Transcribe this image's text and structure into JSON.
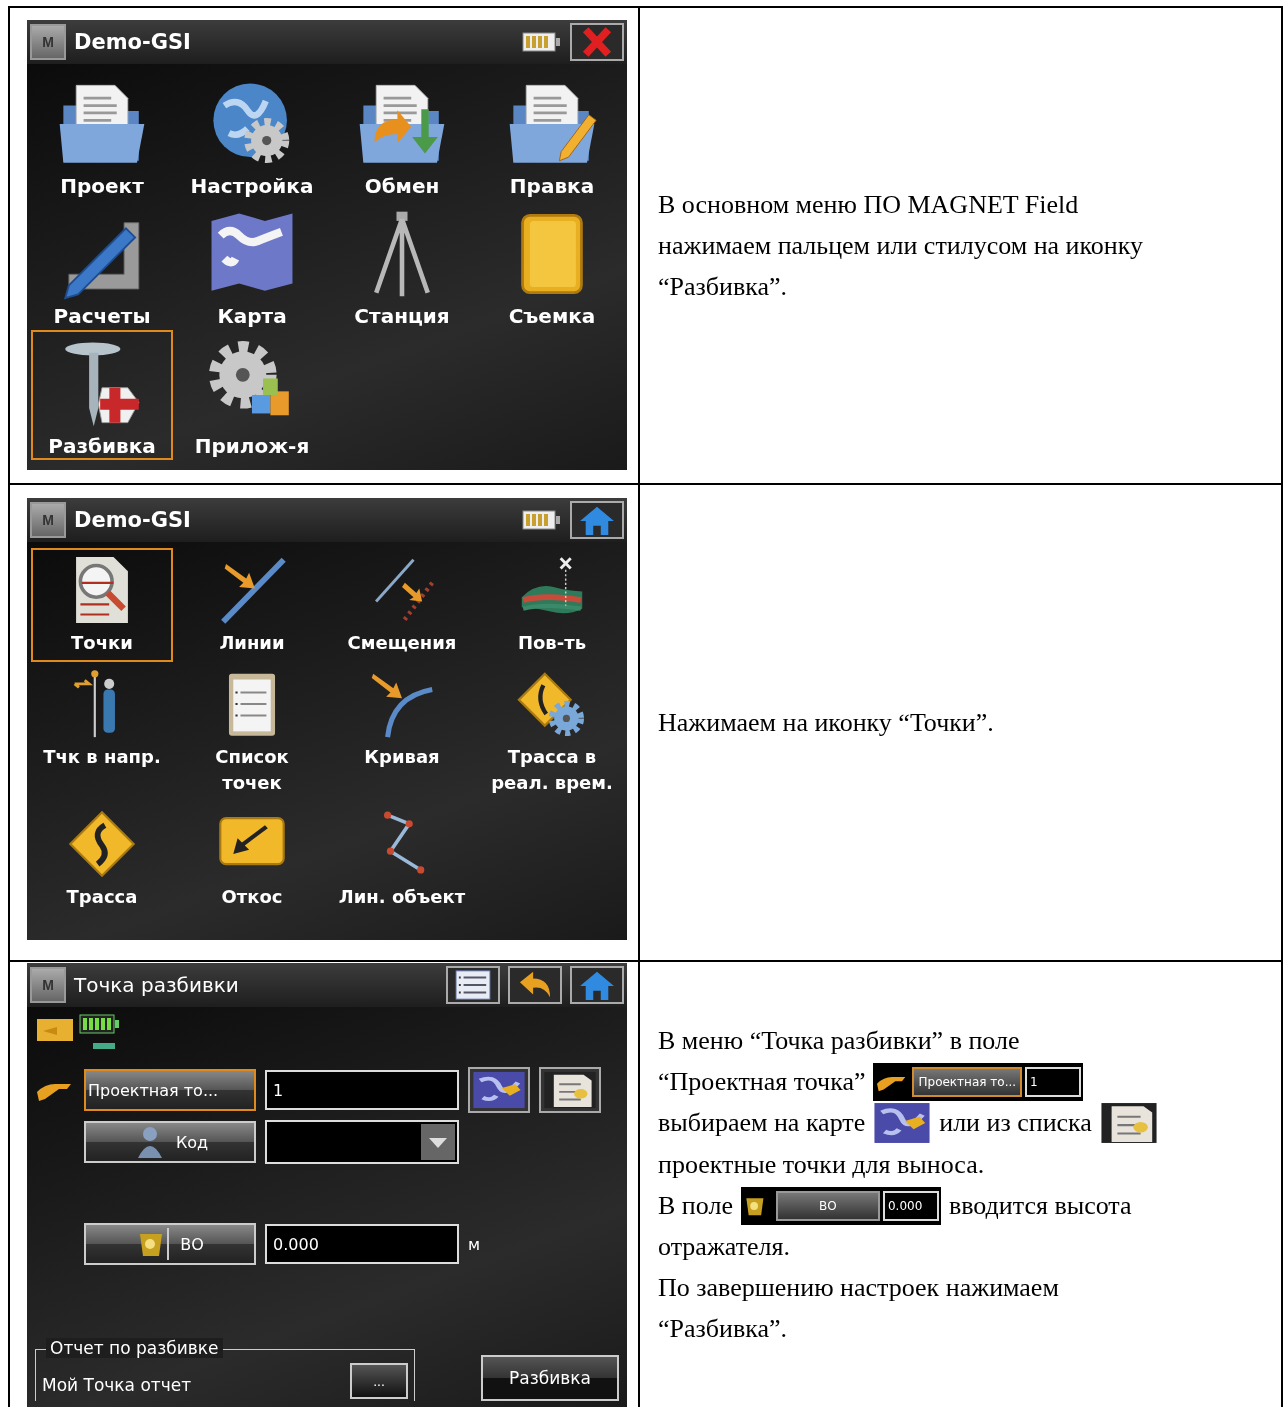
{
  "rows": [
    {
      "screen": {
        "kind": "menu",
        "logo": "M",
        "title": "Demo-GSI",
        "toolbar": [
          {
            "kind": "close"
          }
        ],
        "items": [
          {
            "label": "Проект",
            "selected": false
          },
          {
            "label": "Настройка",
            "selected": false
          },
          {
            "label": "Обмен",
            "selected": false
          },
          {
            "label": "Правка",
            "selected": false
          },
          {
            "label": "Расчеты",
            "selected": false
          },
          {
            "label": "Карта",
            "selected": false
          },
          {
            "label": "Станция",
            "selected": false
          },
          {
            "label": "Съемка",
            "selected": false
          },
          {
            "label": "Разбивка",
            "selected": true
          },
          {
            "label": "Прилож-я",
            "selected": false
          }
        ]
      },
      "note": {
        "lines": [
          [
            {
              "kind": "text",
              "text": "В основном меню ПО MAGNET Field"
            }
          ],
          [
            {
              "kind": "text",
              "text": "нажимаем пальцем или стилусом на иконку"
            }
          ],
          [
            {
              "kind": "text",
              "text": "“Разбивка”."
            }
          ]
        ]
      }
    },
    {
      "screen": {
        "kind": "menu",
        "logo": "M",
        "title": "Demo-GSI",
        "toolbar": [
          {
            "kind": "home"
          }
        ],
        "items": [
          {
            "label": "Точки",
            "selected": true
          },
          {
            "label": "Линии",
            "selected": false
          },
          {
            "label": "Смещения",
            "selected": false
          },
          {
            "label": "Пов-ть",
            "selected": false
          },
          {
            "label": "Тчк в напр.",
            "selected": false
          },
          {
            "label": "Список точек",
            "selected": false
          },
          {
            "label": "Кривая",
            "selected": false
          },
          {
            "label": "Трасса в реал. врем.",
            "selected": false
          },
          {
            "label": "Трасса",
            "selected": false
          },
          {
            "label": "Откос",
            "selected": false
          },
          {
            "label": "Лин. объект",
            "selected": false
          }
        ]
      },
      "note": {
        "lines": [
          [
            {
              "kind": "text",
              "text": "Нажимаем на иконку “Точки”."
            }
          ]
        ]
      }
    },
    {
      "screen": {
        "kind": "form",
        "logo": "M",
        "title": "Точка разбивки",
        "toolbar": [
          {
            "kind": "list"
          },
          {
            "kind": "back"
          },
          {
            "kind": "home"
          }
        ],
        "point": {
          "label": "Проектная то...",
          "focused": true,
          "value": "1"
        },
        "code": {
          "label": "Код"
        },
        "height": {
          "label": "ВО",
          "value": "0.000",
          "unit": "м"
        },
        "report": {
          "legend": "Отчет по разбивке",
          "value": "Мой Точка отчет",
          "browse": "..."
        },
        "stakeout_button": "Разбивка"
      },
      "note": {
        "lines": [
          [
            {
              "kind": "text",
              "text": "В меню “Точка разбивки” в поле"
            }
          ],
          [
            {
              "kind": "text",
              "text": "“Проектная точка”"
            },
            {
              "kind": "point_field",
              "label": "Проектная то...",
              "value": "1"
            }
          ],
          [
            {
              "kind": "text",
              "text": "выбираем на карте"
            },
            {
              "kind": "map_button"
            },
            {
              "kind": "text",
              "text": "или из списка"
            },
            {
              "kind": "list_button"
            }
          ],
          [
            {
              "kind": "text",
              "text": "проектные точки для выноса."
            }
          ],
          [
            {
              "kind": "text",
              "text": "В поле"
            },
            {
              "kind": "height_field",
              "label": "ВО",
              "value": "0.000"
            },
            {
              "kind": "text",
              "text": "вводится высота"
            }
          ],
          [
            {
              "kind": "text",
              "text": "отражателя."
            }
          ],
          [
            {
              "kind": "text",
              "text": "По завершению настроек нажимаем"
            }
          ],
          [
            {
              "kind": "text",
              "text": "“Разбивка”."
            }
          ]
        ]
      }
    }
  ]
}
